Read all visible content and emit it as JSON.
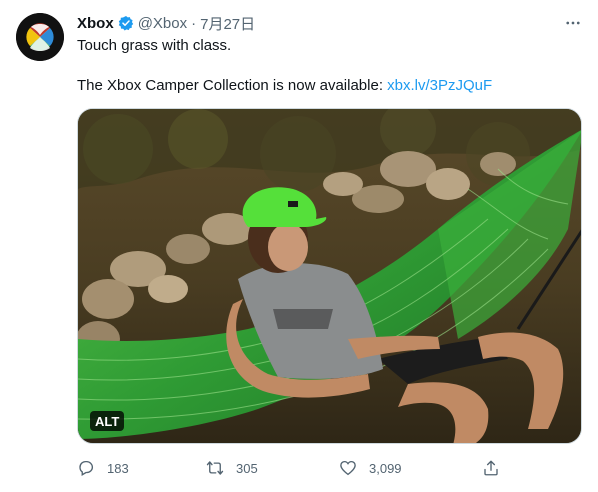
{
  "author": {
    "name": "Xbox",
    "handle": "@Xbox",
    "separator": "·",
    "date": "7月27日",
    "verified": true
  },
  "tweet": {
    "line1": "Touch grass with class.",
    "line2_prefix": "The Xbox Camper Collection is now available: ",
    "link_text": "xbx.lv/3PzJQuF"
  },
  "media": {
    "alt_label": "ALT"
  },
  "actions": {
    "replies": "183",
    "retweets": "305",
    "likes": "3,099"
  },
  "icons": {
    "verified": "verified-badge-icon",
    "more": "more-dots-icon",
    "reply": "reply-icon",
    "retweet": "retweet-icon",
    "like": "heart-icon",
    "share": "share-icon"
  },
  "colors": {
    "link": "#1d9bf0",
    "secondary_text": "#536471",
    "xbox_green": "#107c10",
    "hammock_green": "#3fae3a"
  }
}
